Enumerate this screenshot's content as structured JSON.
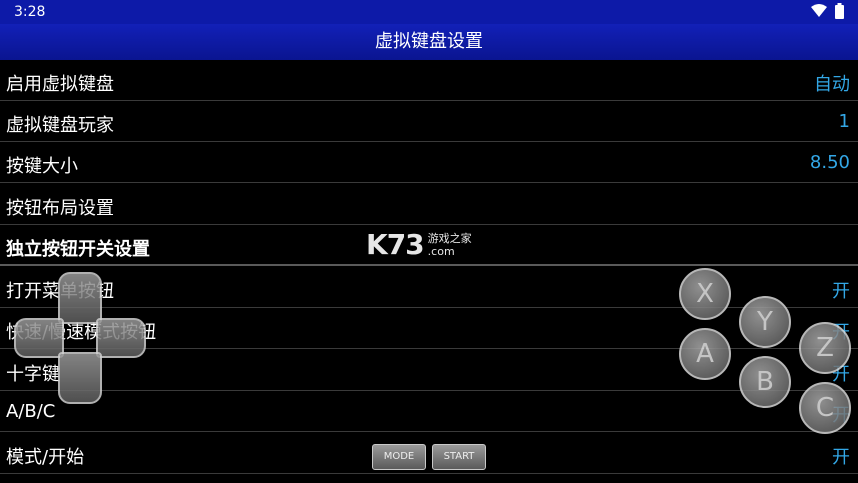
{
  "status_bar": {
    "time": "3:28",
    "icons": [
      "wifi-icon",
      "battery-icon"
    ]
  },
  "title": "虚拟键盘设置",
  "rows": [
    {
      "label": "启用虚拟键盘",
      "value": "自动"
    },
    {
      "label": "虚拟键盘玩家",
      "value": "1"
    },
    {
      "label": "按键大小",
      "value": "8.50"
    },
    {
      "label": "按钮布局设置",
      "value": ""
    },
    {
      "label": "独立按钮开关设置",
      "value": ""
    },
    {
      "label": "打开菜单按钮",
      "value": "开"
    },
    {
      "label": "快速/慢速模式按钮",
      "value": "开"
    },
    {
      "label": "十字键",
      "value": "开"
    },
    {
      "label": "A/B/C",
      "value": "开"
    },
    {
      "label": "模式/开始",
      "value": "开"
    }
  ],
  "overlay_buttons": {
    "x": "X",
    "y": "Y",
    "z": "Z",
    "a": "A",
    "b": "B",
    "c": "C",
    "mode": "MODE",
    "start": "START"
  },
  "watermark": {
    "logo": "K73",
    "line1": "游戏之家",
    "line2": ".com"
  },
  "colors": {
    "status_bar": "#0d1aa8",
    "title_bar": "#1220b8",
    "value_text": "#33a7e6",
    "background": "#000000"
  }
}
